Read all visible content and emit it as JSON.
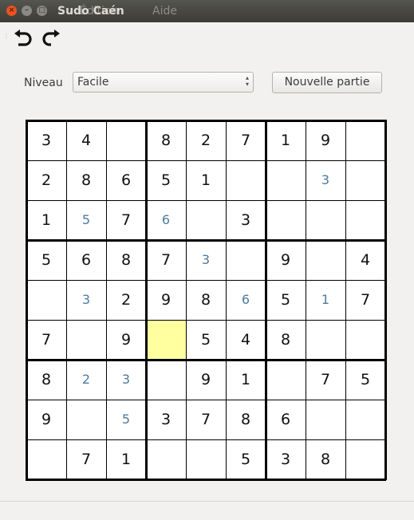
{
  "window": {
    "title": "Sudo Caén",
    "menu": [
      "Édition",
      "Aide"
    ]
  },
  "toolbar": {
    "undo_icon": "undo-arrow-icon",
    "redo_icon": "redo-arrow-icon"
  },
  "controls": {
    "level_label": "Niveau",
    "level_value": "Facile",
    "new_game_label": "Nouvelle partie"
  },
  "board": {
    "rows": [
      [
        "3",
        "4",
        "",
        "8",
        "2",
        "7",
        "1",
        "9",
        ""
      ],
      [
        "2",
        "8",
        "6",
        "5",
        "1",
        "",
        "",
        "3",
        ""
      ],
      [
        "1",
        "5",
        "7",
        "6",
        "",
        "3",
        "",
        "",
        ""
      ],
      [
        "5",
        "6",
        "8",
        "7",
        "3",
        "",
        "9",
        "",
        "4"
      ],
      [
        "",
        "3",
        "2",
        "9",
        "8",
        "6",
        "5",
        "1",
        "7"
      ],
      [
        "7",
        "",
        "9",
        "",
        "5",
        "4",
        "8",
        "",
        ""
      ],
      [
        "8",
        "2",
        "3",
        "",
        "9",
        "1",
        "",
        "7",
        "5"
      ],
      [
        "9",
        "",
        "5",
        "3",
        "7",
        "8",
        "6",
        "",
        ""
      ],
      [
        "",
        "7",
        "1",
        "",
        "",
        "5",
        "3",
        "8",
        ""
      ]
    ],
    "user_entries": [
      [
        1,
        7
      ],
      [
        2,
        1
      ],
      [
        2,
        3
      ],
      [
        3,
        4
      ],
      [
        4,
        1
      ],
      [
        4,
        5
      ],
      [
        4,
        7
      ],
      [
        6,
        1
      ],
      [
        6,
        2
      ],
      [
        7,
        2
      ]
    ],
    "selected_cell": [
      5,
      3
    ],
    "colors": {
      "given": "#111111",
      "user": "#4f7a99",
      "selected": "#ffff9f"
    }
  }
}
